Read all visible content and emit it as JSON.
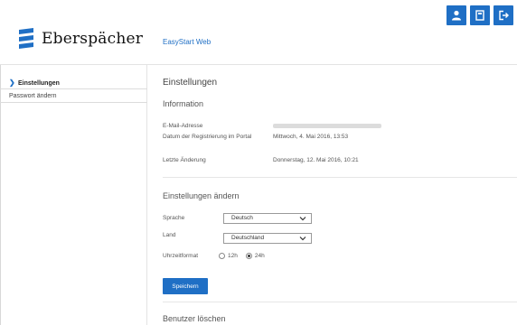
{
  "brand": {
    "name": "Eberspächer",
    "app_link": "EasyStart Web",
    "accent": "#1f6fc5"
  },
  "header_icons": [
    {
      "name": "user-icon"
    },
    {
      "name": "book-icon"
    },
    {
      "name": "logout-icon"
    }
  ],
  "sidebar": {
    "items": [
      {
        "label": "Einstellungen",
        "active": true
      },
      {
        "label": "Passwort ändern",
        "active": false
      }
    ]
  },
  "main": {
    "title": "Einstellungen",
    "info": {
      "heading": "Information",
      "rows": [
        {
          "label": "E-Mail-Adresse",
          "value": ""
        },
        {
          "label": "Datum der Registrierung im Portal",
          "value": "Mittwoch, 4. Mai 2016, 13:53"
        },
        {
          "label": "Letzte Änderung",
          "value": "Donnerstag, 12. Mai 2016, 10:21"
        }
      ]
    },
    "settings": {
      "heading": "Einstellungen ändern",
      "language_label": "Sprache",
      "language_value": "Deutsch",
      "country_label": "Land",
      "country_value": "Deutschland",
      "time_label": "Uhrzeitformat",
      "time_options": [
        "12h",
        "24h"
      ],
      "time_selected": "24h",
      "save_label": "Speichern"
    },
    "delete_heading": "Benutzer löschen"
  }
}
